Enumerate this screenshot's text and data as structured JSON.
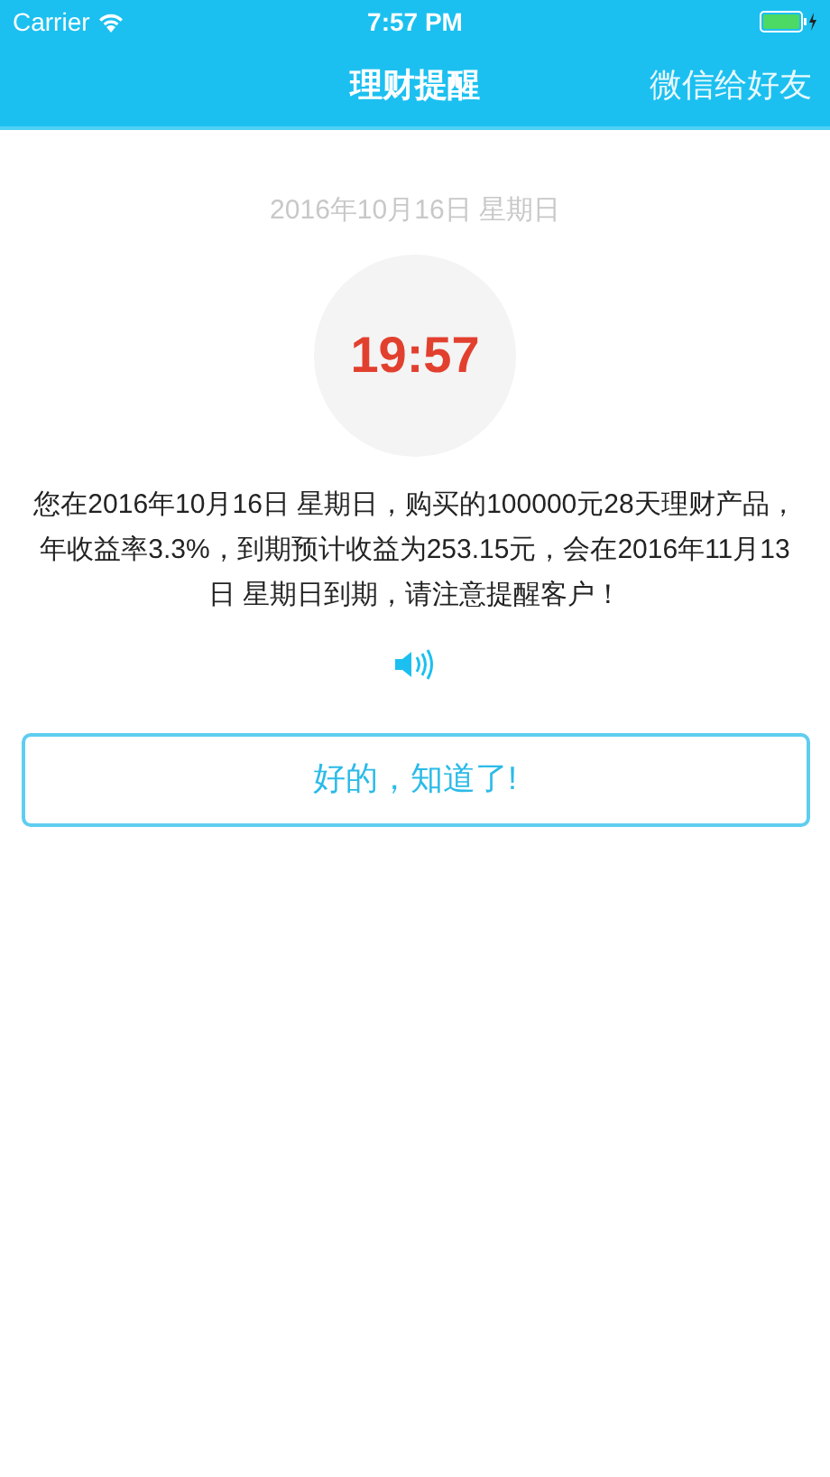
{
  "status_bar": {
    "carrier": "Carrier",
    "time": "7:57 PM"
  },
  "nav_bar": {
    "title": "理财提醒",
    "action": "微信给好友"
  },
  "date": "2016年10月16日 星期日",
  "clock": "19:57",
  "message": "您在2016年10月16日 星期日，购买的100000元28天理财产品，年收益率3.3%，到期预计收益为253.15元，会在2016年11月13日 星期日到期，请注意提醒客户！",
  "confirm_button": "好的，知道了!"
}
